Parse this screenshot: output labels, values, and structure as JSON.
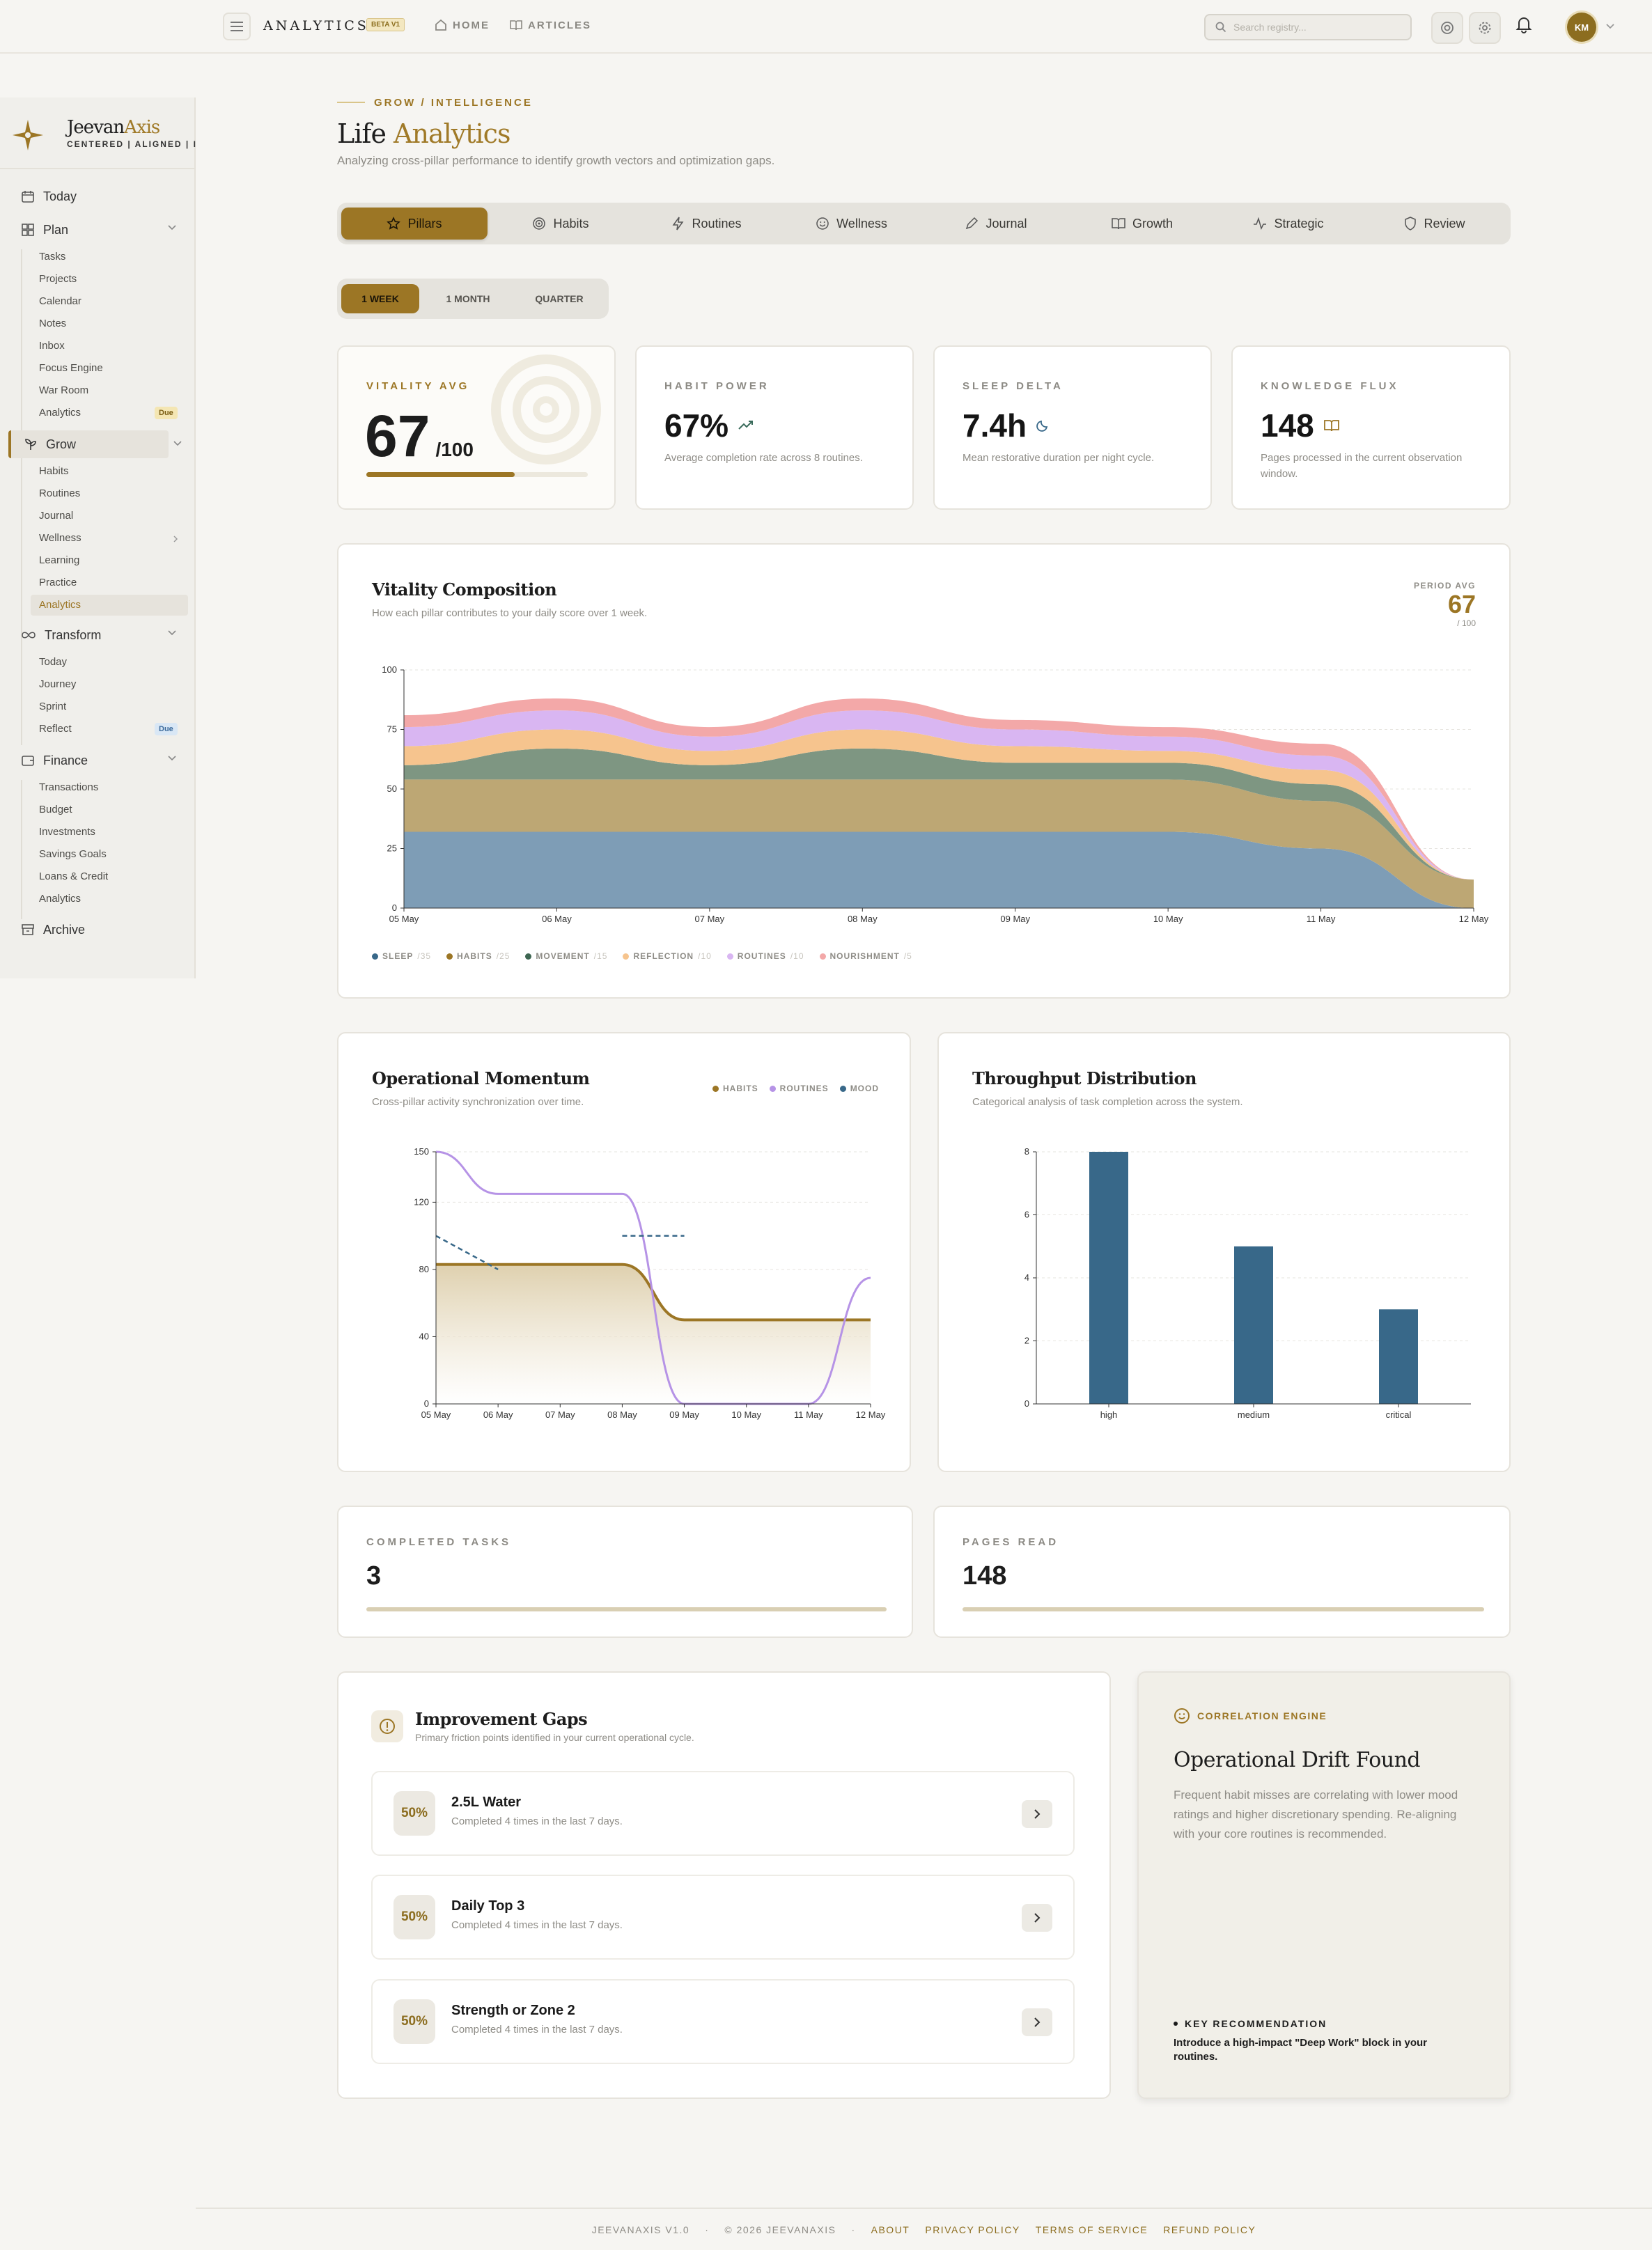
{
  "header": {
    "brand": "ANALYTICS",
    "badge": "BETA V1",
    "nav": [
      "HOME",
      "ARTICLES"
    ],
    "search_placeholder": "Search registry...",
    "avatar_initials": "KM"
  },
  "sidebar": {
    "brand_name": "Jeevan",
    "brand_accent": "Axis",
    "tagline": "CENTERED | ALIGNED | IN",
    "today": "Today",
    "plan": {
      "label": "Plan",
      "items": [
        "Tasks",
        "Projects",
        "Calendar",
        "Notes",
        "Inbox",
        "Focus Engine",
        "War Room",
        "Analytics"
      ],
      "due": "Due"
    },
    "grow": {
      "label": "Grow",
      "items": [
        "Habits",
        "Routines",
        "Journal",
        "Wellness",
        "Learning",
        "Practice",
        "Analytics"
      ]
    },
    "transform": {
      "label": "Transform",
      "items": [
        "Today",
        "Journey",
        "Sprint",
        "Reflect"
      ],
      "due": "Due"
    },
    "finance": {
      "label": "Finance",
      "items": [
        "Transactions",
        "Budget",
        "Investments",
        "Savings Goals",
        "Loans & Credit",
        "Analytics"
      ]
    },
    "archive": "Archive"
  },
  "page": {
    "eyebrow": "GROW / INTELLIGENCE",
    "title_plain": "Life",
    "title_accent": "Analytics",
    "subtitle": "Analyzing cross-pillar performance to identify growth vectors and optimization gaps."
  },
  "tabs": [
    "Pillars",
    "Habits",
    "Routines",
    "Wellness",
    "Journal",
    "Growth",
    "Strategic",
    "Review"
  ],
  "periods": [
    "1 WEEK",
    "1 MONTH",
    "QUARTER"
  ],
  "kpis": {
    "vitality": {
      "label": "VITALITY AVG",
      "value": "67",
      "unit": "/100",
      "progress": 0.67
    },
    "habit": {
      "label": "HABIT POWER",
      "value": "67%",
      "desc": "Average completion rate across 8 routines."
    },
    "sleep": {
      "label": "SLEEP DELTA",
      "value": "7.4h",
      "desc": "Mean restorative duration per night cycle."
    },
    "knowledge": {
      "label": "KNOWLEDGE FLUX",
      "value": "148",
      "desc": "Pages processed in the current observation window."
    }
  },
  "vitality_chart": {
    "title": "Vitality Composition",
    "subtitle": "How each pillar contributes to your daily score over 1 week.",
    "period_label": "PERIOD AVG",
    "period_value": "67",
    "period_unit": "/ 100",
    "legend": [
      {
        "name": "SLEEP",
        "weight": "/35"
      },
      {
        "name": "HABITS",
        "weight": "/25"
      },
      {
        "name": "MOVEMENT",
        "weight": "/15"
      },
      {
        "name": "REFLECTION",
        "weight": "/10"
      },
      {
        "name": "ROUTINES",
        "weight": "/10"
      },
      {
        "name": "NOURISHMENT",
        "weight": "/5"
      }
    ]
  },
  "momentum_chart": {
    "title": "Operational Momentum",
    "subtitle": "Cross-pillar activity synchronization over time.",
    "legend": [
      "HABITS",
      "ROUTINES",
      "MOOD"
    ]
  },
  "throughput_chart": {
    "title": "Throughput Distribution",
    "subtitle": "Categorical analysis of task completion across the system."
  },
  "stats": {
    "completed_label": "COMPLETED TASKS",
    "completed_value": "3",
    "pages_label": "PAGES READ",
    "pages_value": "148"
  },
  "gaps": {
    "title": "Improvement Gaps",
    "subtitle": "Primary friction points identified in your current operational cycle.",
    "items": [
      {
        "pct": "50%",
        "name": "2.5L Water",
        "desc": "Completed 4 times in the last 7 days."
      },
      {
        "pct": "50%",
        "name": "Daily Top 3",
        "desc": "Completed 4 times in the last 7 days."
      },
      {
        "pct": "50%",
        "name": "Strength or Zone 2",
        "desc": "Completed 4 times in the last 7 days."
      }
    ]
  },
  "correlation": {
    "eyebrow": "CORRELATION ENGINE",
    "title": "Operational Drift Found",
    "body": "Frequent habit misses are correlating with lower mood ratings and higher discretionary spending. Re-aligning with your core routines is recommended.",
    "rec_label": "KEY RECOMMENDATION",
    "rec_text": "Introduce a high-impact \"Deep Work\" block in your routines."
  },
  "footer": {
    "version": "JEEVANAXIS V1.0",
    "copyright": "© 2026 JEEVANAXIS",
    "links": [
      "ABOUT",
      "PRIVACY POLICY",
      "TERMS OF SERVICE",
      "REFUND POLICY"
    ]
  },
  "colors": {
    "accent": "#9c7625",
    "sleep": "#7e9db6",
    "habits": "#bda774",
    "movement": "#7e9682",
    "reflection": "#f6c48e",
    "routines": "#d9b6f2",
    "nourishment": "#f3a8a8",
    "bar": "#386889"
  },
  "chart_data": [
    {
      "type": "area",
      "stacked": true,
      "x": [
        "05 May",
        "06 May",
        "07 May",
        "08 May",
        "09 May",
        "10 May",
        "11 May",
        "12 May"
      ],
      "ylim": [
        0,
        100
      ],
      "yticks": [
        0,
        25,
        50,
        75,
        100
      ],
      "series": [
        {
          "name": "SLEEP",
          "values": [
            32,
            32,
            32,
            32,
            32,
            32,
            25,
            0
          ]
        },
        {
          "name": "HABITS",
          "values": [
            22,
            22,
            22,
            22,
            22,
            22,
            20,
            12
          ]
        },
        {
          "name": "MOVEMENT",
          "values": [
            6,
            13,
            6,
            13,
            7,
            7,
            7,
            0
          ]
        },
        {
          "name": "REFLECTION",
          "values": [
            8,
            8,
            6,
            8,
            7,
            5,
            6,
            0
          ]
        },
        {
          "name": "ROUTINES",
          "values": [
            8,
            8,
            6,
            8,
            7,
            6,
            6,
            0
          ]
        },
        {
          "name": "NOURISHMENT",
          "values": [
            5,
            5,
            4,
            5,
            4,
            4,
            5,
            0
          ]
        }
      ]
    },
    {
      "type": "line",
      "x": [
        "05 May",
        "06 May",
        "07 May",
        "08 May",
        "09 May",
        "10 May",
        "11 May",
        "12 May"
      ],
      "ylim": [
        0,
        150
      ],
      "yticks": [
        0,
        40,
        80,
        120,
        150
      ],
      "series": [
        {
          "name": "HABITS",
          "values": [
            83,
            83,
            83,
            83,
            50,
            50,
            50,
            50
          ]
        },
        {
          "name": "ROUTINES",
          "values": [
            150,
            125,
            125,
            125,
            0,
            0,
            0,
            75
          ]
        },
        {
          "name": "MOOD",
          "values": [
            100,
            80,
            null,
            100,
            100,
            null,
            null,
            null
          ]
        }
      ]
    },
    {
      "type": "bar",
      "categories": [
        "high",
        "medium",
        "critical"
      ],
      "values": [
        8,
        5,
        3
      ],
      "ylim": [
        0,
        8
      ],
      "yticks": [
        0,
        2,
        4,
        6,
        8
      ]
    }
  ]
}
